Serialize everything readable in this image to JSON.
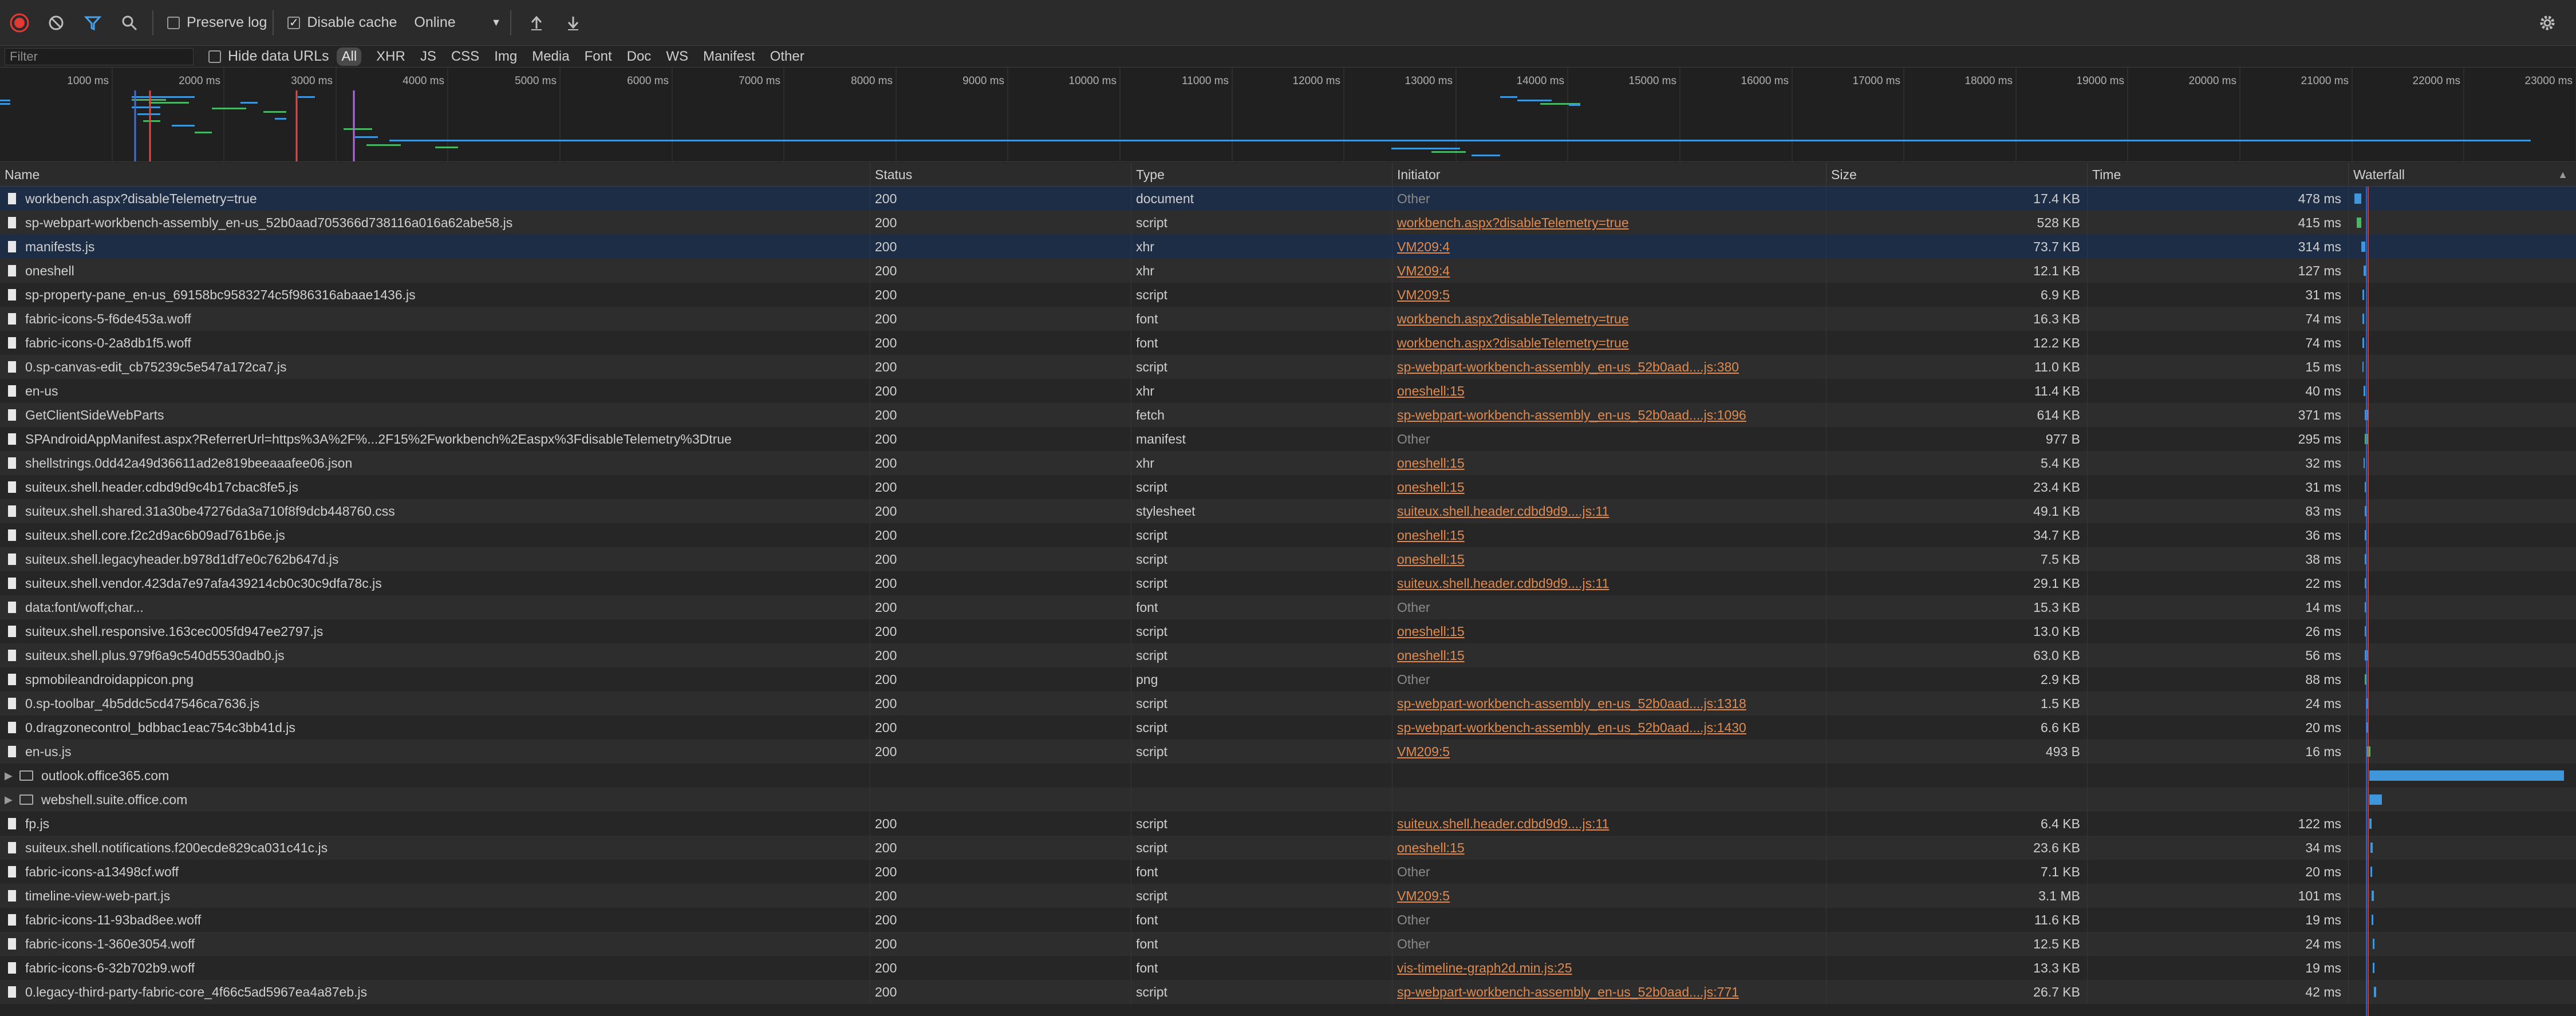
{
  "toolbar": {
    "preserve_log_label": "Preserve log",
    "preserve_log_checked": false,
    "disable_cache_label": "Disable cache",
    "disable_cache_checked": true,
    "throttling_value": "Online"
  },
  "filterbar": {
    "filter_placeholder": "Filter",
    "hide_data_urls_label": "Hide data URLs",
    "types": [
      "All",
      "XHR",
      "JS",
      "CSS",
      "Img",
      "Media",
      "Font",
      "Doc",
      "WS",
      "Manifest",
      "Other"
    ]
  },
  "overview": {
    "ticks": [
      "1000 ms",
      "2000 ms",
      "3000 ms",
      "4000 ms",
      "5000 ms",
      "6000 ms",
      "7000 ms",
      "8000 ms",
      "9000 ms",
      "10000 ms",
      "11000 ms",
      "12000 ms",
      "13000 ms",
      "14000 ms",
      "15000 ms",
      "16000 ms",
      "17000 ms",
      "18000 ms",
      "19000 ms",
      "20000 ms",
      "21000 ms",
      "22000 ms",
      "23000 ms"
    ]
  },
  "columns": {
    "name": "Name",
    "status": "Status",
    "type": "Type",
    "initiator": "Initiator",
    "size": "Size",
    "time": "Time",
    "waterfall": "Waterfall"
  },
  "colors": {
    "selected_row": "#1c2d45",
    "link": "#e08a4f",
    "waterfall_blue": "#3f96d8",
    "waterfall_green": "#4bb566",
    "record_red": "#e53935"
  },
  "requests": [
    {
      "name": "workbench.aspx?disableTelemetry=true",
      "status": "200",
      "type": "document",
      "initiator": "Other",
      "initiator_link": false,
      "size": "17.4 KB",
      "time": "478 ms",
      "selected": true
    },
    {
      "name": "sp-webpart-workbench-assembly_en-us_52b0aad705366d738116a016a62abe58.js",
      "status": "200",
      "type": "script",
      "initiator": "workbench.aspx?disableTelemetry=true",
      "initiator_link": true,
      "size": "528 KB",
      "time": "415 ms",
      "selected": false
    },
    {
      "name": "manifests.js",
      "status": "200",
      "type": "xhr",
      "initiator": "VM209:4",
      "initiator_link": true,
      "size": "73.7 KB",
      "time": "314 ms",
      "selected": true
    },
    {
      "name": "oneshell",
      "status": "200",
      "type": "xhr",
      "initiator": "VM209:4",
      "initiator_link": true,
      "size": "12.1 KB",
      "time": "127 ms",
      "selected": false
    },
    {
      "name": "sp-property-pane_en-us_69158bc9583274c5f986316abaae1436.js",
      "status": "200",
      "type": "script",
      "initiator": "VM209:5",
      "initiator_link": true,
      "size": "6.9 KB",
      "time": "31 ms",
      "selected": false
    },
    {
      "name": "fabric-icons-5-f6de453a.woff",
      "status": "200",
      "type": "font",
      "initiator": "workbench.aspx?disableTelemetry=true",
      "initiator_link": true,
      "size": "16.3 KB",
      "time": "74 ms",
      "selected": false
    },
    {
      "name": "fabric-icons-0-2a8db1f5.woff",
      "status": "200",
      "type": "font",
      "initiator": "workbench.aspx?disableTelemetry=true",
      "initiator_link": true,
      "size": "12.2 KB",
      "time": "74 ms",
      "selected": false
    },
    {
      "name": "0.sp-canvas-edit_cb75239c5e547a172ca7.js",
      "status": "200",
      "type": "script",
      "initiator": "sp-webpart-workbench-assembly_en-us_52b0aad....js:380",
      "initiator_link": true,
      "size": "11.0 KB",
      "time": "15 ms",
      "selected": false
    },
    {
      "name": "en-us",
      "status": "200",
      "type": "xhr",
      "initiator": "oneshell:15",
      "initiator_link": true,
      "size": "11.4 KB",
      "time": "40 ms",
      "selected": false
    },
    {
      "name": "GetClientSideWebParts",
      "status": "200",
      "type": "fetch",
      "initiator": "sp-webpart-workbench-assembly_en-us_52b0aad....js:1096",
      "initiator_link": true,
      "size": "614 KB",
      "time": "371 ms",
      "selected": false
    },
    {
      "name": "SPAndroidAppManifest.aspx?ReferrerUrl=https%3A%2F%...2F15%2Fworkbench%2Easpx%3FdisableTelemetry%3Dtrue",
      "status": "200",
      "type": "manifest",
      "initiator": "Other",
      "initiator_link": false,
      "size": "977 B",
      "time": "295 ms",
      "selected": false
    },
    {
      "name": "shellstrings.0dd42a49d36611ad2e819beeaaafee06.json",
      "status": "200",
      "type": "xhr",
      "initiator": "oneshell:15",
      "initiator_link": true,
      "size": "5.4 KB",
      "time": "32 ms",
      "selected": false
    },
    {
      "name": "suiteux.shell.header.cdbd9d9c4b17cbac8fe5.js",
      "status": "200",
      "type": "script",
      "initiator": "oneshell:15",
      "initiator_link": true,
      "size": "23.4 KB",
      "time": "31 ms",
      "selected": false
    },
    {
      "name": "suiteux.shell.shared.31a30be47276da3a710f8f9dcb448760.css",
      "status": "200",
      "type": "stylesheet",
      "initiator": "suiteux.shell.header.cdbd9d9....js:11",
      "initiator_link": true,
      "size": "49.1 KB",
      "time": "83 ms",
      "selected": false
    },
    {
      "name": "suiteux.shell.core.f2c2d9ac6b09ad761b6e.js",
      "status": "200",
      "type": "script",
      "initiator": "oneshell:15",
      "initiator_link": true,
      "size": "34.7 KB",
      "time": "36 ms",
      "selected": false
    },
    {
      "name": "suiteux.shell.legacyheader.b978d1df7e0c762b647d.js",
      "status": "200",
      "type": "script",
      "initiator": "oneshell:15",
      "initiator_link": true,
      "size": "7.5 KB",
      "time": "38 ms",
      "selected": false
    },
    {
      "name": "suiteux.shell.vendor.423da7e97afa439214cb0c30c9dfa78c.js",
      "status": "200",
      "type": "script",
      "initiator": "suiteux.shell.header.cdbd9d9....js:11",
      "initiator_link": true,
      "size": "29.1 KB",
      "time": "22 ms",
      "selected": false
    },
    {
      "name": "data:font/woff;char...",
      "status": "200",
      "type": "font",
      "initiator": "Other",
      "initiator_link": false,
      "size": "15.3 KB",
      "time": "14 ms",
      "selected": false
    },
    {
      "name": "suiteux.shell.responsive.163cec005fd947ee2797.js",
      "status": "200",
      "type": "script",
      "initiator": "oneshell:15",
      "initiator_link": true,
      "size": "13.0 KB",
      "time": "26 ms",
      "selected": false
    },
    {
      "name": "suiteux.shell.plus.979f6a9c540d5530adb0.js",
      "status": "200",
      "type": "script",
      "initiator": "oneshell:15",
      "initiator_link": true,
      "size": "63.0 KB",
      "time": "56 ms",
      "selected": false
    },
    {
      "name": "spmobileandroidappicon.png",
      "status": "200",
      "type": "png",
      "initiator": "Other",
      "initiator_link": false,
      "size": "2.9 KB",
      "time": "88 ms",
      "selected": false
    },
    {
      "name": "0.sp-toolbar_4b5ddc5cd47546ca7636.js",
      "status": "200",
      "type": "script",
      "initiator": "sp-webpart-workbench-assembly_en-us_52b0aad....js:1318",
      "initiator_link": true,
      "size": "1.5 KB",
      "time": "24 ms",
      "selected": false
    },
    {
      "name": "0.dragzonecontrol_bdbbac1eac754c3bb41d.js",
      "status": "200",
      "type": "script",
      "initiator": "sp-webpart-workbench-assembly_en-us_52b0aad....js:1430",
      "initiator_link": true,
      "size": "6.6 KB",
      "time": "20 ms",
      "selected": false
    },
    {
      "name": "en-us.js",
      "status": "200",
      "type": "script",
      "initiator": "VM209:5",
      "initiator_link": true,
      "size": "493 B",
      "time": "16 ms",
      "selected": false
    },
    {
      "name": "outlook.office365.com",
      "group": true
    },
    {
      "name": "webshell.suite.office.com",
      "group": true
    },
    {
      "name": "fp.js",
      "status": "200",
      "type": "script",
      "initiator": "suiteux.shell.header.cdbd9d9....js:11",
      "initiator_link": true,
      "size": "6.4 KB",
      "time": "122 ms",
      "selected": false
    },
    {
      "name": "suiteux.shell.notifications.f200ecde829ca031c41c.js",
      "status": "200",
      "type": "script",
      "initiator": "oneshell:15",
      "initiator_link": true,
      "size": "23.6 KB",
      "time": "34 ms",
      "selected": false
    },
    {
      "name": "fabric-icons-a13498cf.woff",
      "status": "200",
      "type": "font",
      "initiator": "Other",
      "initiator_link": false,
      "size": "7.1 KB",
      "time": "20 ms",
      "selected": false
    },
    {
      "name": "timeline-view-web-part.js",
      "status": "200",
      "type": "script",
      "initiator": "VM209:5",
      "initiator_link": true,
      "size": "3.1 MB",
      "time": "101 ms",
      "selected": false
    },
    {
      "name": "fabric-icons-11-93bad8ee.woff",
      "status": "200",
      "type": "font",
      "initiator": "Other",
      "initiator_link": false,
      "size": "11.6 KB",
      "time": "19 ms",
      "selected": false
    },
    {
      "name": "fabric-icons-1-360e3054.woff",
      "status": "200",
      "type": "font",
      "initiator": "Other",
      "initiator_link": false,
      "size": "12.5 KB",
      "time": "24 ms",
      "selected": false
    },
    {
      "name": "fabric-icons-6-32b702b9.woff",
      "status": "200",
      "type": "font",
      "initiator": "vis-timeline-graph2d.min.js:25",
      "initiator_link": true,
      "size": "13.3 KB",
      "time": "19 ms",
      "selected": false
    },
    {
      "name": "0.legacy-third-party-fabric-core_4f66c5ad5967ea4a87eb.js",
      "status": "200",
      "type": "script",
      "initiator": "sp-webpart-workbench-assembly_en-us_52b0aad....js:771",
      "initiator_link": true,
      "size": "26.7 KB",
      "time": "42 ms",
      "selected": false
    }
  ]
}
